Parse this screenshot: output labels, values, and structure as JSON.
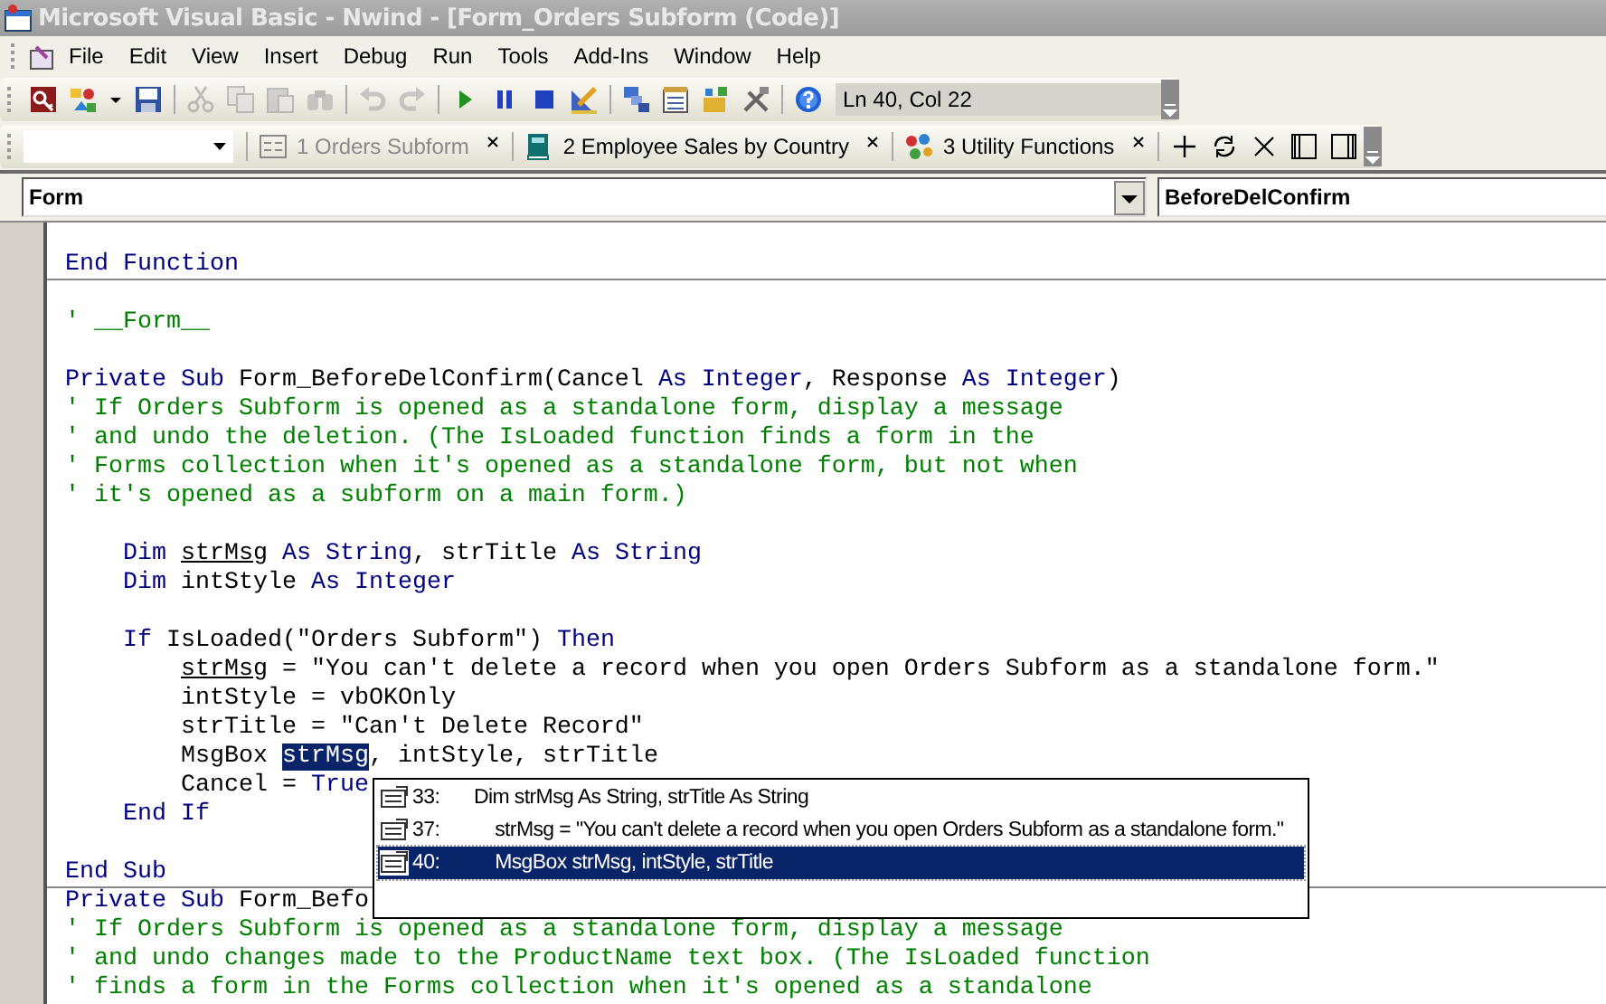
{
  "window": {
    "title": "Microsoft Visual Basic - Nwind - [Form_Orders Subform (Code)]"
  },
  "menu": [
    "File",
    "Edit",
    "View",
    "Insert",
    "Debug",
    "Run",
    "Tools",
    "Add-Ins",
    "Window",
    "Help"
  ],
  "toolbar": [
    {
      "kind": "access",
      "disabled": false
    },
    {
      "kind": "insert",
      "disabled": false
    },
    {
      "kind": "caret",
      "disabled": false
    },
    {
      "kind": "save",
      "disabled": false
    },
    {
      "kind": "sep"
    },
    {
      "kind": "cut",
      "disabled": true
    },
    {
      "kind": "copy",
      "disabled": true
    },
    {
      "kind": "paste",
      "disabled": true
    },
    {
      "kind": "find",
      "disabled": true
    },
    {
      "kind": "sep"
    },
    {
      "kind": "undo",
      "disabled": true
    },
    {
      "kind": "redo",
      "disabled": true
    },
    {
      "kind": "sep"
    },
    {
      "kind": "run",
      "disabled": false
    },
    {
      "kind": "pause",
      "disabled": false
    },
    {
      "kind": "stop",
      "disabled": false
    },
    {
      "kind": "design",
      "disabled": false
    },
    {
      "kind": "sep"
    },
    {
      "kind": "project",
      "disabled": false
    },
    {
      "kind": "properties",
      "disabled": false
    },
    {
      "kind": "browser",
      "disabled": false
    },
    {
      "kind": "toolbox",
      "disabled": false
    },
    {
      "kind": "sep"
    },
    {
      "kind": "help",
      "disabled": false
    }
  ],
  "position": "Ln 40, Col 22",
  "tabs": [
    {
      "label": "1 Orders Subform",
      "kind": "form",
      "selected": false,
      "disabled": true
    },
    {
      "label": "2 Employee Sales by Country",
      "kind": "book",
      "selected": false,
      "disabled": false
    },
    {
      "label": "3 Utility Functions",
      "kind": "module",
      "selected": false,
      "disabled": false
    }
  ],
  "tab_actions": [
    {
      "kind": "add"
    },
    {
      "kind": "refresh"
    },
    {
      "kind": "close"
    },
    {
      "kind": "left-pane"
    },
    {
      "kind": "right-pane"
    }
  ],
  "object_box": {
    "value": "Form"
  },
  "procedure_box": {
    "value": "BeforeDelConfirm"
  },
  "code": [
    {
      "blank_before": true,
      "divider_after": true,
      "segments": [
        {
          "kind": "keyword",
          "text": "End Function"
        }
      ]
    },
    {
      "blank_before": true,
      "divider_after": false,
      "segments": [
        {
          "kind": "comment",
          "text": "' __Form__"
        }
      ]
    },
    {
      "blank_before": true,
      "divider_after": false,
      "segments": [
        {
          "kind": "keyword",
          "text": "Private Sub"
        },
        {
          "kind": "plain",
          "text": " Form_BeforeDelConfirm(Cancel "
        },
        {
          "kind": "keyword",
          "text": "As Integer"
        },
        {
          "kind": "plain",
          "text": ", Response "
        },
        {
          "kind": "keyword",
          "text": "As Integer"
        },
        {
          "kind": "plain",
          "text": ")"
        }
      ]
    },
    {
      "blank_before": false,
      "divider_after": false,
      "segments": [
        {
          "kind": "comment",
          "text": "' If Orders Subform is opened as a standalone form, display a message"
        }
      ]
    },
    {
      "blank_before": false,
      "divider_after": false,
      "segments": [
        {
          "kind": "comment",
          "text": "' and undo the deletion. (The IsLoaded function finds a form in the"
        }
      ]
    },
    {
      "blank_before": false,
      "divider_after": false,
      "segments": [
        {
          "kind": "comment",
          "text": "' Forms collection when it's opened as a standalone form, but not when"
        }
      ]
    },
    {
      "blank_before": false,
      "divider_after": false,
      "segments": [
        {
          "kind": "comment",
          "text": "' it's opened as a subform on a main form.)"
        }
      ]
    },
    {
      "blank_before": true,
      "divider_after": false,
      "segments": [
        {
          "kind": "keyword",
          "text": "    Dim "
        },
        {
          "kind": "marked",
          "text": "strMsg"
        },
        {
          "kind": "keyword",
          "text": " As String"
        },
        {
          "kind": "plain",
          "text": ", strTitle "
        },
        {
          "kind": "keyword",
          "text": "As String"
        }
      ]
    },
    {
      "blank_before": false,
      "divider_after": false,
      "segments": [
        {
          "kind": "keyword",
          "text": "    Dim"
        },
        {
          "kind": "plain",
          "text": " intStyle "
        },
        {
          "kind": "keyword",
          "text": "As Integer"
        }
      ]
    },
    {
      "blank_before": true,
      "divider_after": false,
      "segments": [
        {
          "kind": "keyword",
          "text": "    If"
        },
        {
          "kind": "plain",
          "text": " IsLoaded(\"Orders Subform\") "
        },
        {
          "kind": "keyword",
          "text": "Then"
        }
      ]
    },
    {
      "blank_before": false,
      "divider_after": false,
      "segments": [
        {
          "kind": "marked",
          "text": "        strMsg"
        },
        {
          "kind": "plain",
          "text": " = \"You can't delete a record when you open Orders Subform as a standalone form.\""
        }
      ]
    },
    {
      "blank_before": false,
      "divider_after": false,
      "segments": [
        {
          "kind": "plain",
          "text": "        intStyle = vbOKOnly"
        }
      ]
    },
    {
      "blank_before": false,
      "divider_after": false,
      "segments": [
        {
          "kind": "plain",
          "text": "        strTitle = \"Can't Delete Record\""
        }
      ]
    },
    {
      "blank_before": false,
      "divider_after": false,
      "segments": [
        {
          "kind": "plain",
          "text": "        MsgBox "
        },
        {
          "kind": "selected",
          "text": "strMsg"
        },
        {
          "kind": "plain",
          "text": ", intStyle, strTitle"
        }
      ]
    },
    {
      "blank_before": false,
      "divider_after": false,
      "segments": [
        {
          "kind": "plain",
          "text": "        Cancel = "
        },
        {
          "kind": "keyword",
          "text": "True"
        }
      ]
    },
    {
      "blank_before": false,
      "divider_after": false,
      "segments": [
        {
          "kind": "keyword",
          "text": "    End If"
        }
      ]
    },
    {
      "blank_before": true,
      "divider_after": true,
      "segments": [
        {
          "kind": "keyword",
          "text": "End Sub"
        }
      ]
    },
    {
      "blank_before": false,
      "divider_after": false,
      "segments": [
        {
          "kind": "keyword",
          "text": "Private Sub"
        },
        {
          "kind": "plain",
          "text": " Form_Befo"
        }
      ]
    },
    {
      "blank_before": false,
      "divider_after": false,
      "segments": [
        {
          "kind": "comment",
          "text": "' If Orders Subform is opened as a standalone form, display a message"
        }
      ]
    },
    {
      "blank_before": false,
      "divider_after": false,
      "segments": [
        {
          "kind": "comment",
          "text": "' and undo changes made to the ProductName text box. (The IsLoaded function"
        }
      ]
    },
    {
      "blank_before": false,
      "divider_after": false,
      "segments": [
        {
          "kind": "comment",
          "text": "' finds a form in the Forms collection when it's opened as a standalone"
        }
      ]
    }
  ],
  "references": [
    {
      "line": "33:",
      "text": "Dim strMsg As String, strTitle As String",
      "selected": false
    },
    {
      "line": "37:",
      "text": "    strMsg = \"You can't delete a record when you open Orders Subform as a standalone form.\"",
      "selected": false
    },
    {
      "line": "40:",
      "text": "    MsgBox strMsg, intStyle, strTitle",
      "selected": true
    }
  ]
}
